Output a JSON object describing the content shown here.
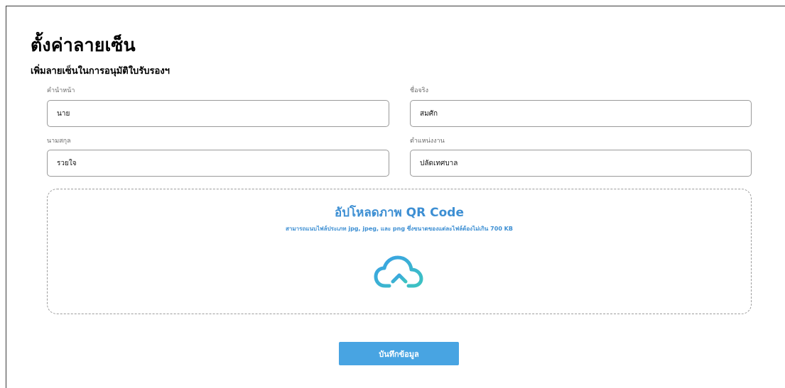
{
  "page": {
    "title": "ตั้งค่าลายเซ็น",
    "subtitle": "เพิ่มลายเซ็นในการอนุมัติใบรับรองฯ"
  },
  "form": {
    "prefix": {
      "label": "คำนำหน้า",
      "value": "นาย"
    },
    "first_name": {
      "label": "ชื่อจริง",
      "value": "สมศัก"
    },
    "last_name": {
      "label": "นามสกุล",
      "value": "รวยใจ"
    },
    "position": {
      "label": "ตำแหน่งงาน",
      "value": "ปลัดเทศบาล"
    }
  },
  "upload": {
    "title": "อัปโหลดภาพ QR Code",
    "description": "สามารถแนบไฟล์ประเภท jpg, jpeg, และ png ซึ่งขนาดของแต่ละไฟล์ต้องไม่เกิน 700 KB",
    "icon": "cloud-upload-icon"
  },
  "actions": {
    "save_label": "บันทึกข้อมูล"
  },
  "colors": {
    "accent": "#3d8fd3",
    "button": "#48a4e2",
    "icon_gradient_start": "#3aa0e6",
    "icon_gradient_end": "#3cc3c1"
  }
}
